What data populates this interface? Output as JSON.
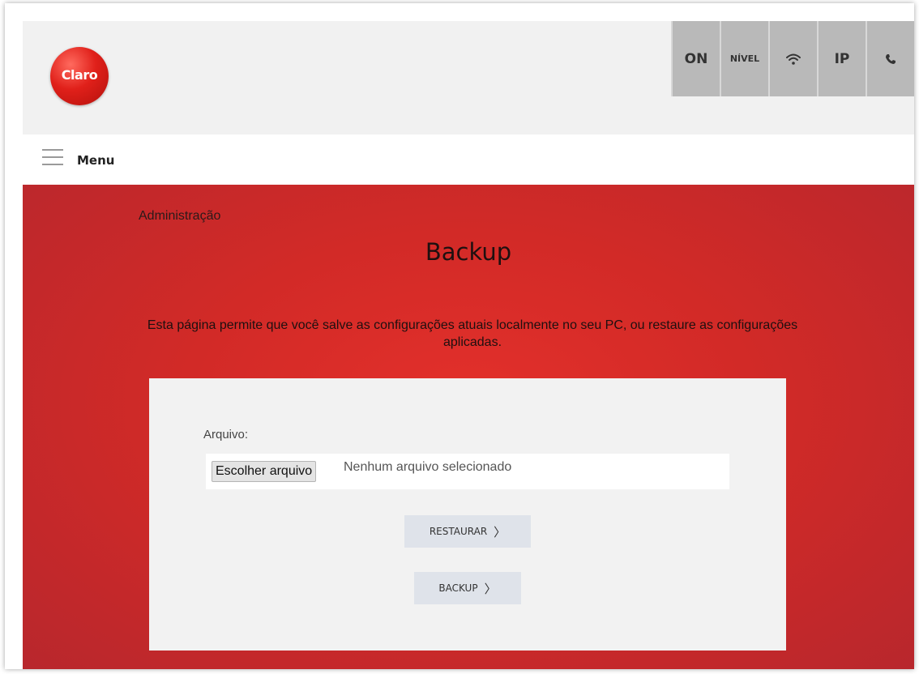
{
  "header": {
    "logo_text": "Claro",
    "status_items": {
      "on": "ON",
      "nivel": "NÍVEL",
      "wifi_icon": "wifi-icon",
      "ip": "IP",
      "phone_icon": "phone-icon"
    }
  },
  "menu": {
    "label": "Menu",
    "icon": "hamburger-icon"
  },
  "main": {
    "breadcrumb": "Administração",
    "title": "Backup",
    "description": "Esta página permite que você salve as configurações atuais localmente no seu PC, ou restaure as configurações aplicadas.",
    "file": {
      "label": "Arquivo:",
      "choose_button": "Escolher arquivo",
      "status": "Nenhum arquivo selecionado"
    },
    "buttons": {
      "restore": "RESTAURAR",
      "backup": "BACKUP",
      "chevron": "〉"
    }
  },
  "colors": {
    "brand_red": "#d22a27",
    "header_bg": "#f1f1f1",
    "status_bg": "#b9b9b9",
    "card_bg": "#f2f2f2",
    "button_bg": "#dfe3ea"
  }
}
